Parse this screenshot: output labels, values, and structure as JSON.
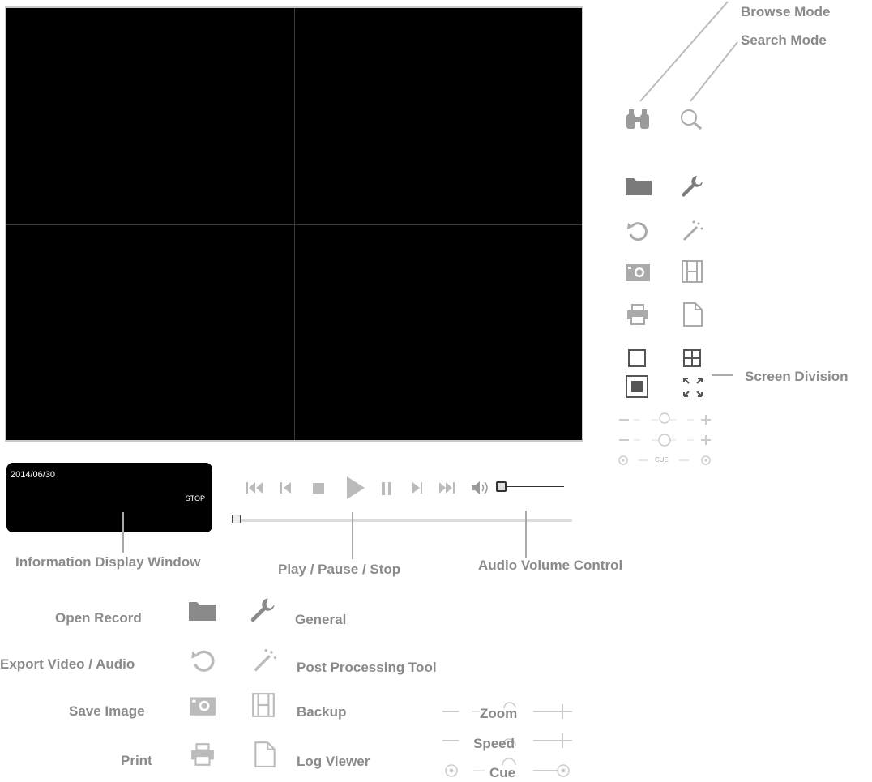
{
  "info_display": {
    "date": "2014/06/30",
    "status": "STOP"
  },
  "callouts": {
    "browse_mode": "Browse Mode",
    "search_mode": "Search Mode",
    "screen_division": "Screen Division",
    "info_window": "Information Display Window",
    "play_pause_stop": "Play / Pause / Stop",
    "audio_volume": "Audio Volume Control"
  },
  "legend": {
    "open_record": "Open Record",
    "general": "General",
    "export": "Export Video / Audio",
    "post_processing": "Post Processing Tool",
    "save_image": "Save Image",
    "backup": "Backup",
    "print": "Print",
    "log_viewer": "Log Viewer",
    "zoom": "Zoom",
    "speed": "Speed",
    "cue": "Cue"
  },
  "sliders": {
    "cue_small": "CUE",
    "seek_position": 0,
    "volume_level": 0
  },
  "icon_color": "#8a8a8a"
}
